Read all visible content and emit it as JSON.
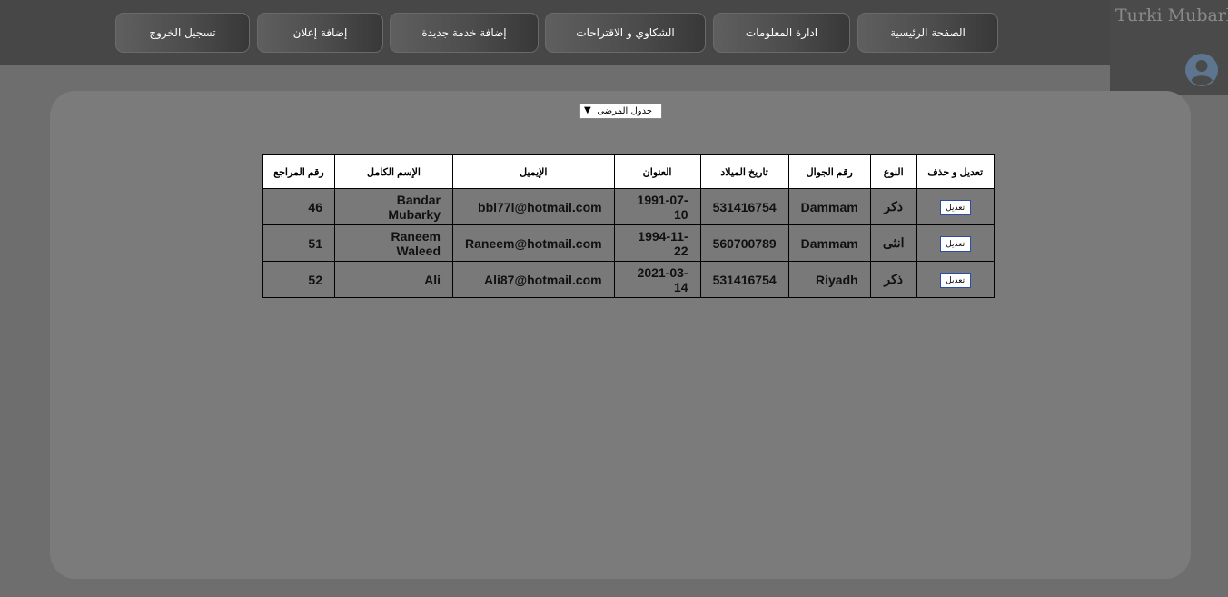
{
  "nav": {
    "items": [
      {
        "label": "الصفحة الرئيسية"
      },
      {
        "label": "ادارة المعلومات"
      },
      {
        "label": "الشكاوي و الاقتراحات"
      },
      {
        "label": "إضافة خدمة جديدة"
      },
      {
        "label": "إضافة إعلان"
      },
      {
        "label": "تسجيل الخروج"
      }
    ]
  },
  "user": {
    "name": "Turki Mubarky",
    "icon": "user-avatar-icon"
  },
  "table_select": {
    "value": "جدول المرضى"
  },
  "table": {
    "headers": {
      "patient_id": "رقم المراجع",
      "full_name": "الإسم الكامل",
      "email": "الإيميل",
      "address": "العنوان",
      "birth_date": "تاريخ الميلاد",
      "phone": "رقم الجوال",
      "gender": "النوع",
      "actions": "تعديل و حذف"
    },
    "rows": [
      {
        "patient_id": "46",
        "full_name": "Bandar Mubarky",
        "email": "bbl77l@hotmail.com",
        "address": "Dammam",
        "birth_date": "1991-07-10",
        "phone": "531416754",
        "gender": "ذكر",
        "edit_label": "تعديل"
      },
      {
        "patient_id": "51",
        "full_name": "Raneem Waleed",
        "email": "Raneem@hotmail.com",
        "address": "Dammam",
        "birth_date": "1994-11-22",
        "phone": "560700789",
        "gender": "انثى",
        "edit_label": "تعديل"
      },
      {
        "patient_id": "52",
        "full_name": "Ali",
        "email": "Ali87@hotmail.com",
        "address": "Riyadh",
        "birth_date": "2021-03-14",
        "phone": "531416754",
        "gender": "ذكر",
        "edit_label": "تعديل"
      }
    ]
  }
}
